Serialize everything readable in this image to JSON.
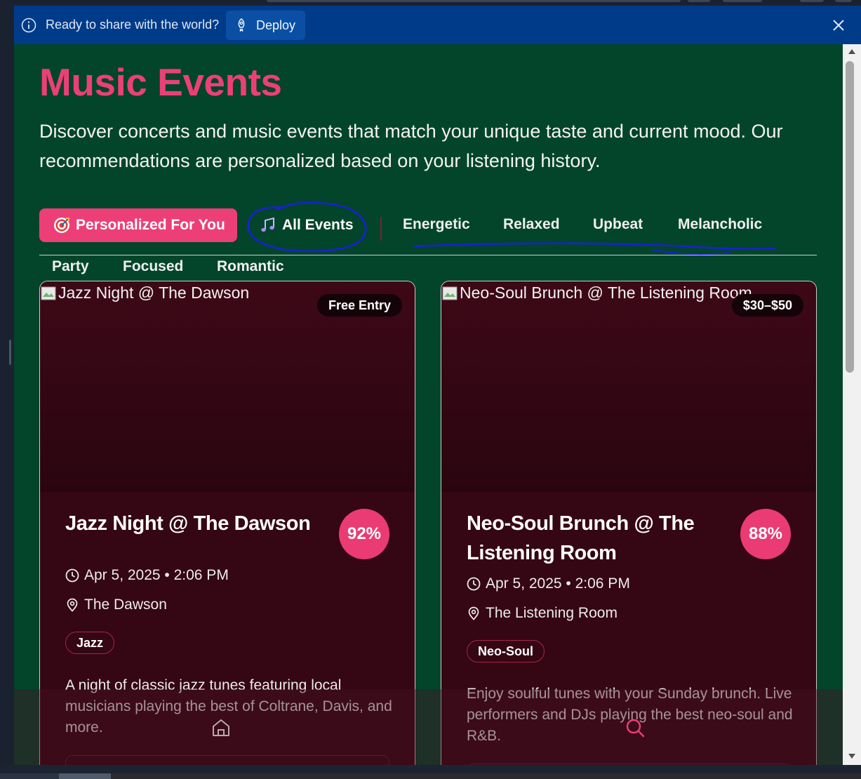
{
  "banner": {
    "message": "Ready to share with the world?",
    "deploy_label": "Deploy",
    "background": "#003b8a"
  },
  "page": {
    "title": "Music Events",
    "intro": "Discover concerts and music events that match your unique taste and current mood. Our recommendations are personalized based on your listening history.",
    "accent": "#ec3f78",
    "background": "#02452b"
  },
  "filters": {
    "personalized": {
      "emoji": "target-icon",
      "label": "Personalized For You",
      "active": true
    },
    "all": {
      "emoji": "music-notes-icon",
      "label": "All Events",
      "active": false
    },
    "moods": [
      "Energetic",
      "Relaxed",
      "Upbeat",
      "Melancholic",
      "Party",
      "Focused",
      "Romantic"
    ]
  },
  "events": [
    {
      "image_alt": "Jazz Night @ The Dawson",
      "price": "Free Entry",
      "title": "Jazz Night @ The Dawson",
      "match": "92%",
      "datetime": "Apr 5, 2025 • 2:06 PM",
      "venue": "The Dawson",
      "genre": "Jazz",
      "description": "A night of classic jazz tunes featuring local musicians playing the best of Coltrane, Davis, and more."
    },
    {
      "image_alt": "Neo-Soul Brunch @ The Listening Room",
      "price": "$30–$50",
      "title": "Neo-Soul Brunch @ The Listening Room",
      "match": "88%",
      "datetime": "Apr 5, 2025 • 2:06 PM",
      "venue": "The Listening Room",
      "genre": "Neo-Soul",
      "description": "Enjoy soulful tunes with your Sunday brunch. Live performers and DJs playing the best neo-soul and R&B."
    }
  ],
  "bottom_nav": {
    "items": [
      "home-icon",
      "search-icon"
    ]
  }
}
